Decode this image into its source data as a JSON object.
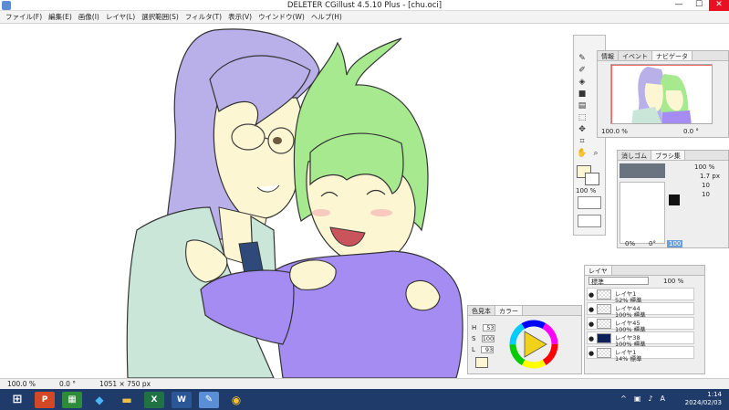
{
  "window": {
    "title": "DELETER CGillust 4.5.10 Plus - [chu.oci]",
    "minimize": "—",
    "maximize": "☐",
    "close": "✕"
  },
  "menu": [
    "ファイル(F)",
    "編集(E)",
    "画像(I)",
    "レイヤ(L)",
    "選択範囲(S)",
    "フィルタ(T)",
    "表示(V)",
    "ウインドウ(W)",
    "ヘルプ(H)"
  ],
  "status": {
    "zoom": "100.0 %",
    "angle": "0.0 °",
    "size": "1051 × 750 px"
  },
  "navigator": {
    "tabs": [
      "情報",
      "イベント",
      "ナビゲータ"
    ],
    "zoom": "100.0",
    "zoom_unit": "%",
    "angle": "0.0",
    "angle_unit": "°"
  },
  "brush_panel": {
    "tabs": [
      "消しゴム",
      "ブラシ集"
    ],
    "opacity": "100",
    "opacity_unit": "%",
    "size": "1.7",
    "size_unit": "px",
    "val1": "10",
    "val2": "10",
    "bottom_pct": "0%",
    "bottom_angle": "0°",
    "bottom_value": "100"
  },
  "toolbox": {
    "percent": "100",
    "percent_unit": "%"
  },
  "layers_panel": {
    "tab": "レイヤ",
    "blend": "標準",
    "opacity": "100",
    "opacity_unit": "%",
    "layers": [
      {
        "name": "レイヤ1",
        "info": "52% 標準"
      },
      {
        "name": "レイヤ44",
        "info": "100% 標準"
      },
      {
        "name": "レイヤ45",
        "info": "100% 標準"
      },
      {
        "name": "レイヤ38",
        "info": "100% 標準"
      },
      {
        "name": "レイヤ1",
        "info": "14% 標準"
      }
    ]
  },
  "color_panel": {
    "tabs": [
      "色見本",
      "カラー"
    ],
    "h_label": "H",
    "h": "53",
    "s_label": "S",
    "s": "100",
    "l_label": "L",
    "l": "93"
  },
  "taskbar": {
    "time": "1:14",
    "date": "2024/02/03",
    "apps": [
      "P",
      "X",
      "W"
    ],
    "ime": "A"
  },
  "colors": {
    "hair_purple": "#b9b0e9",
    "hair_green": "#a6e98e",
    "skin": "#fdf6d2",
    "jacket": "#c9e6d8",
    "hoodie": "#a48cf2",
    "tie": "#2f4a7a",
    "taskbar": "#1f3b6a",
    "close": "#e81123"
  }
}
